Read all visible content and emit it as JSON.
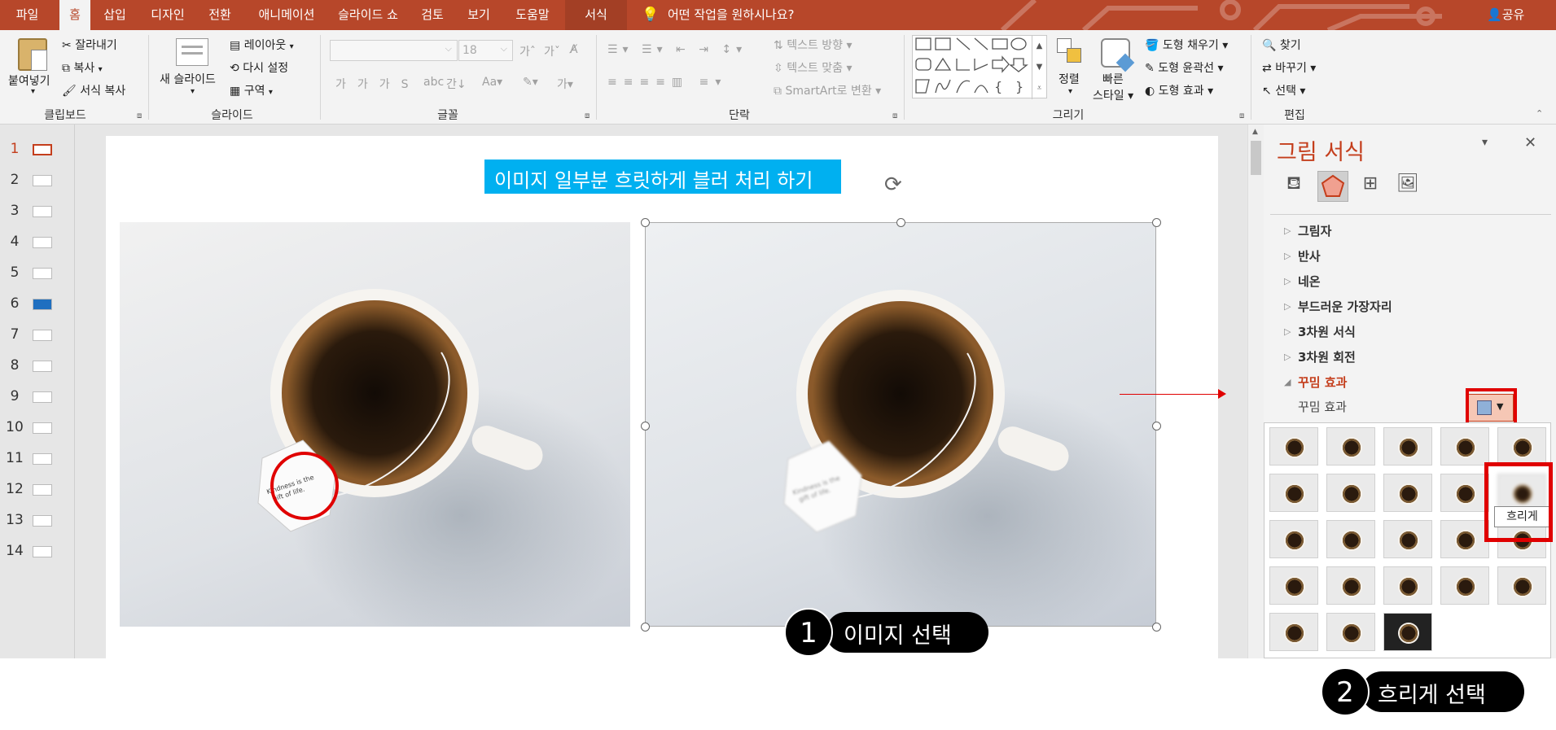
{
  "tabs": {
    "file": "파일",
    "home": "홈",
    "insert": "삽입",
    "design": "디자인",
    "transitions": "전환",
    "animations": "애니메이션",
    "slideshow": "슬라이드 쇼",
    "review": "검토",
    "view": "보기",
    "help": "도움말",
    "format": "서식",
    "tell_me": "어떤 작업을 원하시나요?",
    "share": "공유"
  },
  "ribbon": {
    "clipboard": {
      "paste": "붙여넣기",
      "cut": "잘라내기",
      "copy": "복사",
      "format_painter": "서식 복사",
      "label": "클립보드"
    },
    "slides": {
      "new_slide": "새 슬라이드",
      "layout": "레이아웃",
      "reset": "다시 설정",
      "section": "구역",
      "label": "슬라이드"
    },
    "font": {
      "size": "18",
      "label": "글꼴"
    },
    "paragraph": {
      "text_direction": "텍스트 방향",
      "align_text": "텍스트 맞춤",
      "smartart": "SmartArt로 변환",
      "label": "단락"
    },
    "drawing": {
      "arrange": "정렬",
      "quick_styles_1": "빠른",
      "quick_styles_2": "스타일",
      "shape_fill": "도형 채우기",
      "shape_outline": "도형 윤곽선",
      "shape_effects": "도형 효과",
      "label": "그리기"
    },
    "editing": {
      "find": "찾기",
      "replace": "바꾸기",
      "select": "선택",
      "label": "편집"
    }
  },
  "thumbnails": [
    "1",
    "2",
    "3",
    "4",
    "5",
    "6",
    "7",
    "8",
    "9",
    "10",
    "11",
    "12",
    "13",
    "14"
  ],
  "slide": {
    "title": "이미지 일부분 흐릿하게 블러 처리 하기",
    "tag_text_1": "Kindness is the",
    "tag_text_2": "gift of life."
  },
  "pane": {
    "title": "그림 서식",
    "sections": [
      "그림자",
      "반사",
      "네온",
      "부드러운 가장자리",
      "3차원 서식",
      "3차원 회전"
    ],
    "artistic_header": "꾸밈 효과",
    "artistic_label": "꾸밈 효과",
    "tooltip": "흐리게"
  },
  "callouts": {
    "step1_num": "1",
    "step1_text": "이미지 선택",
    "step2_num": "2",
    "step2_text": "흐리게 선택"
  },
  "colors": {
    "accent": "#b7472a",
    "title_bg": "#00b0f0",
    "highlight": "#e00000"
  }
}
